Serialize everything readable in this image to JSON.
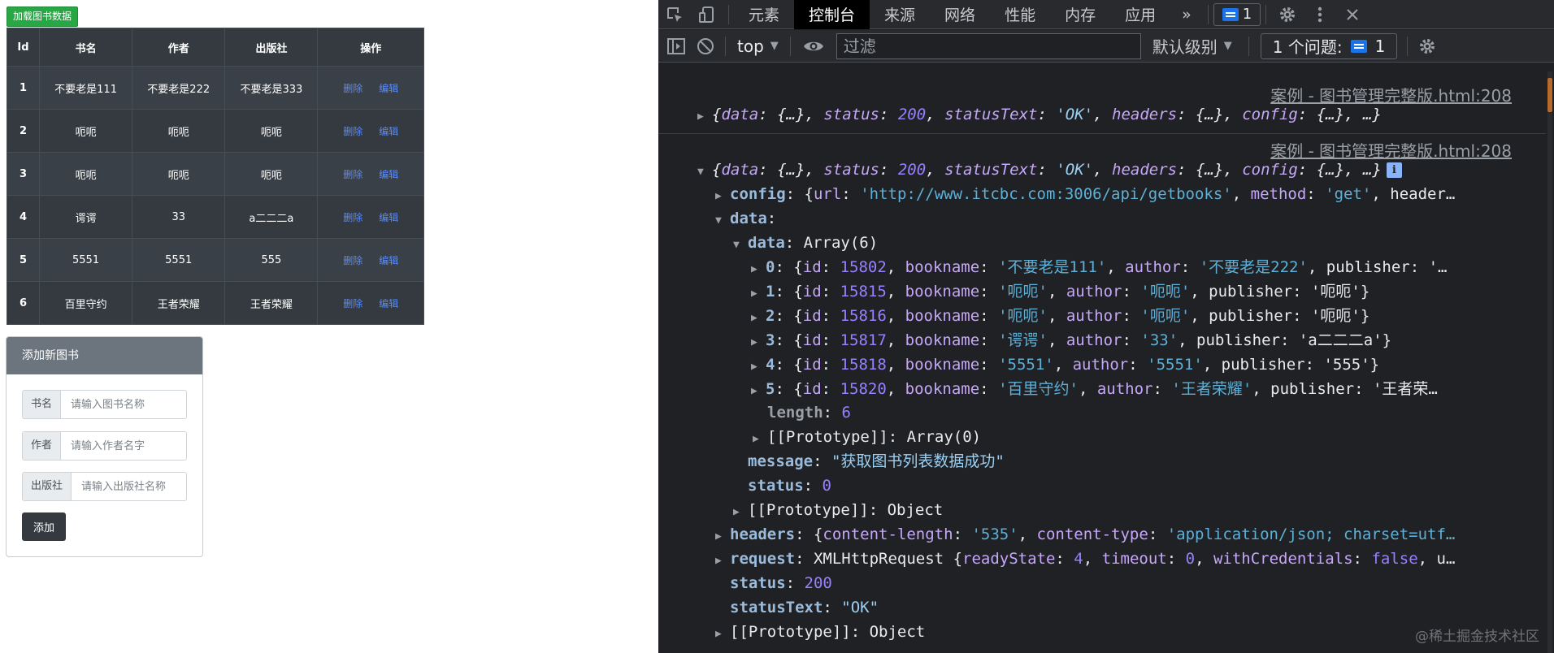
{
  "page": {
    "load_button": "加载图书数据",
    "table": {
      "headers": [
        "Id",
        "书名",
        "作者",
        "出版社",
        "操作"
      ],
      "delete_label": "删除",
      "edit_label": "编辑",
      "rows": [
        {
          "id": "1",
          "bookname": "不要老是111",
          "author": "不要老是222",
          "publisher": "不要老是333"
        },
        {
          "id": "2",
          "bookname": "呃呃",
          "author": "呃呃",
          "publisher": "呃呃"
        },
        {
          "id": "3",
          "bookname": "呃呃",
          "author": "呃呃",
          "publisher": "呃呃"
        },
        {
          "id": "4",
          "bookname": "谔谔",
          "author": "33",
          "publisher": "a二二二a"
        },
        {
          "id": "5",
          "bookname": "5551",
          "author": "5551",
          "publisher": "555"
        },
        {
          "id": "6",
          "bookname": "百里守约",
          "author": "王者荣耀",
          "publisher": "王者荣耀"
        }
      ]
    },
    "form": {
      "title": "添加新图书",
      "name_label": "书名",
      "name_placeholder": "请输入图书名称",
      "author_label": "作者",
      "author_placeholder": "请输入作者名字",
      "publisher_label": "出版社",
      "publisher_placeholder": "请输入出版社名称",
      "submit_label": "添加"
    }
  },
  "devtools": {
    "tabs": [
      "元素",
      "控制台",
      "来源",
      "网络",
      "性能",
      "内存",
      "应用"
    ],
    "active_tab": "控制台",
    "more_tabs": "»",
    "message_count": "1",
    "context": "top",
    "filter_placeholder": "过滤",
    "levels": "默认级别",
    "issues_label": "1 个问题:",
    "issues_count": "1",
    "source_link": "案例 - 图书管理完整版.html:208",
    "watermark": "@稀土掘金技术社区"
  },
  "console": {
    "summary": {
      "pre": "{",
      "data": "data",
      "data_val": "{…}",
      "status_key": "status",
      "status_val": "200",
      "statusText_key": "statusText",
      "statusText_val": "'OK'",
      "headers_key": "headers",
      "headers_val": "{…}",
      "config_key": "config",
      "config_val": "{…}",
      "tail": "…}"
    },
    "config_line": {
      "key": "config",
      "url_key": "url",
      "url_val": "'http://www.itcbc.com:3006/api/getbooks'",
      "method_key": "method",
      "method_val": "'get'",
      "rest": "header…"
    },
    "data_key": "data",
    "data_array_key": "data",
    "data_array_val": "Array(6)",
    "items": [
      {
        "index": "0",
        "id": "15802",
        "bookname": "'不要老是111'",
        "author": "'不要老是222'",
        "tail": ", publisher: '…"
      },
      {
        "index": "1",
        "id": "15815",
        "bookname": "'呃呃'",
        "author": "'呃呃'",
        "tail": ", publisher: '呃呃'}"
      },
      {
        "index": "2",
        "id": "15816",
        "bookname": "'呃呃'",
        "author": "'呃呃'",
        "tail": ", publisher: '呃呃'}"
      },
      {
        "index": "3",
        "id": "15817",
        "bookname": "'谔谔'",
        "author": "'33'",
        "tail": ", publisher: 'a二二二a'}"
      },
      {
        "index": "4",
        "id": "15818",
        "bookname": "'5551'",
        "author": "'5551'",
        "tail": ", publisher: '555'}"
      },
      {
        "index": "5",
        "id": "15820",
        "bookname": "'百里守约'",
        "author": "'王者荣耀'",
        "tail": ", publisher: '王者荣…"
      }
    ],
    "length_key": "length",
    "length_val": "6",
    "proto_array": "[[Prototype]]: Array(0)",
    "message_key": "message",
    "message_val": "\"获取图书列表数据成功\"",
    "status_inner_key": "status",
    "status_inner_val": "0",
    "proto_object": "[[Prototype]]: Object",
    "headers_line": {
      "key": "headers",
      "cl_key": "content-length",
      "cl_val": "'535'",
      "ct_key": "content-type",
      "ct_val": "'application/json; charset=utf…"
    },
    "request_line": {
      "key": "request",
      "type": "XMLHttpRequest",
      "rs_key": "readyState",
      "rs_val": "4",
      "to_key": "timeout",
      "to_val": "0",
      "wc_key": "withCredentials",
      "wc_val": "false",
      "tail": "u…"
    },
    "status_key": "status",
    "status_val": "200",
    "statusText_key": "statusText",
    "statusText_val": "\"OK\"",
    "proto_object2": "[[Prototype]]: Object"
  }
}
